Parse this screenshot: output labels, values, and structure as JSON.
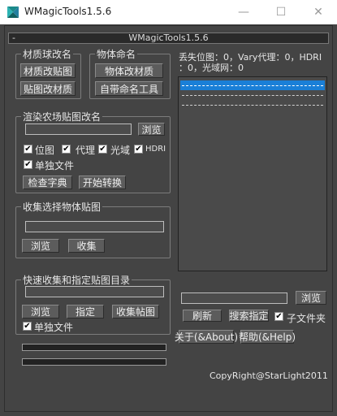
{
  "window": {
    "title": "WMagicTools1.5.6",
    "rollout_title": "WMagicTools1.5.6",
    "rollout_toggle": "-",
    "controls": {
      "minimize": "—",
      "maximize": "☐",
      "close": "✕"
    }
  },
  "material_rename": {
    "title": "材质球改名",
    "btn1": "材质改贴图",
    "btn2": "贴图改材质"
  },
  "object_naming": {
    "title": "物体命名",
    "btn1": "物体改材质",
    "btn2": "自带命名工具"
  },
  "render_rename": {
    "title": "渲染农场贴图改名",
    "path_value": "",
    "browse_label": "浏览",
    "options": [
      {
        "label": "位图",
        "checked": true
      },
      {
        "label": "代理",
        "checked": true
      },
      {
        "label": "光域",
        "checked": true
      },
      {
        "label": "HDRI",
        "checked": true
      }
    ],
    "single_file": {
      "label": "单独文件",
      "checked": true
    },
    "check_dict_label": "检查字典",
    "start_convert_label": "开始转换"
  },
  "collect_selected": {
    "title": "收集选择物体贴图",
    "path_value": "",
    "browse_label": "浏览",
    "collect_label": "收集"
  },
  "quick_collect": {
    "title": "快速收集和指定贴图目录",
    "path_value": "",
    "browse_label": "浏览",
    "assign_label": "指定",
    "collect_maps_label": "收集帖图",
    "single_file": {
      "label": "单独文件",
      "checked": true
    }
  },
  "missing_info": {
    "line1": "丢失位图：0，Vary代理：0，HDRI",
    "line2": "：0，光域网：0"
  },
  "list": {
    "rows": [
      {
        "selected": true
      },
      {
        "selected": false
      },
      {
        "selected": false
      }
    ]
  },
  "right_panel": {
    "path_value": "",
    "browse_label": "浏览",
    "refresh_label": "刷新",
    "search_assign_label": "搜索指定",
    "subfolder": {
      "label": "子文件夹",
      "checked": true
    },
    "about_label": "关于(&About)",
    "help_label": "帮助(&Help)"
  },
  "footer": {
    "copyright": "CopyRight@StarLight2011"
  },
  "colors": {
    "background": "#444444",
    "selection": "#1a7fd7",
    "titlebar": "#ffffff"
  }
}
